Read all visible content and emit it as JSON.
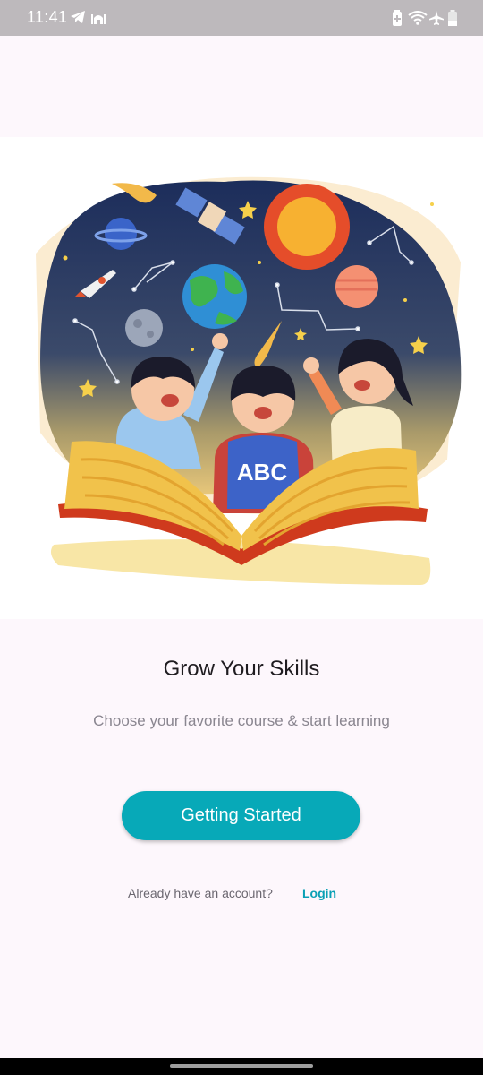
{
  "status_bar": {
    "time": "11:41",
    "left_icons": [
      "telegram-icon",
      "mosque-icon"
    ],
    "right_icons": [
      "battery-saver-icon",
      "wifi-icon",
      "airplane-icon",
      "battery-icon"
    ]
  },
  "hero": {
    "image": "kids-reading-book-illustration"
  },
  "onboarding": {
    "title": "Grow Your Skills",
    "subtitle": "Choose your favorite course & start learning",
    "cta_label": "Getting Started",
    "account_prompt": "Already have an account?",
    "login_label": "Login"
  },
  "colors": {
    "background": "#fdf7fc",
    "accent": "#07a9b8",
    "status_bar": "#bdb9bc"
  }
}
